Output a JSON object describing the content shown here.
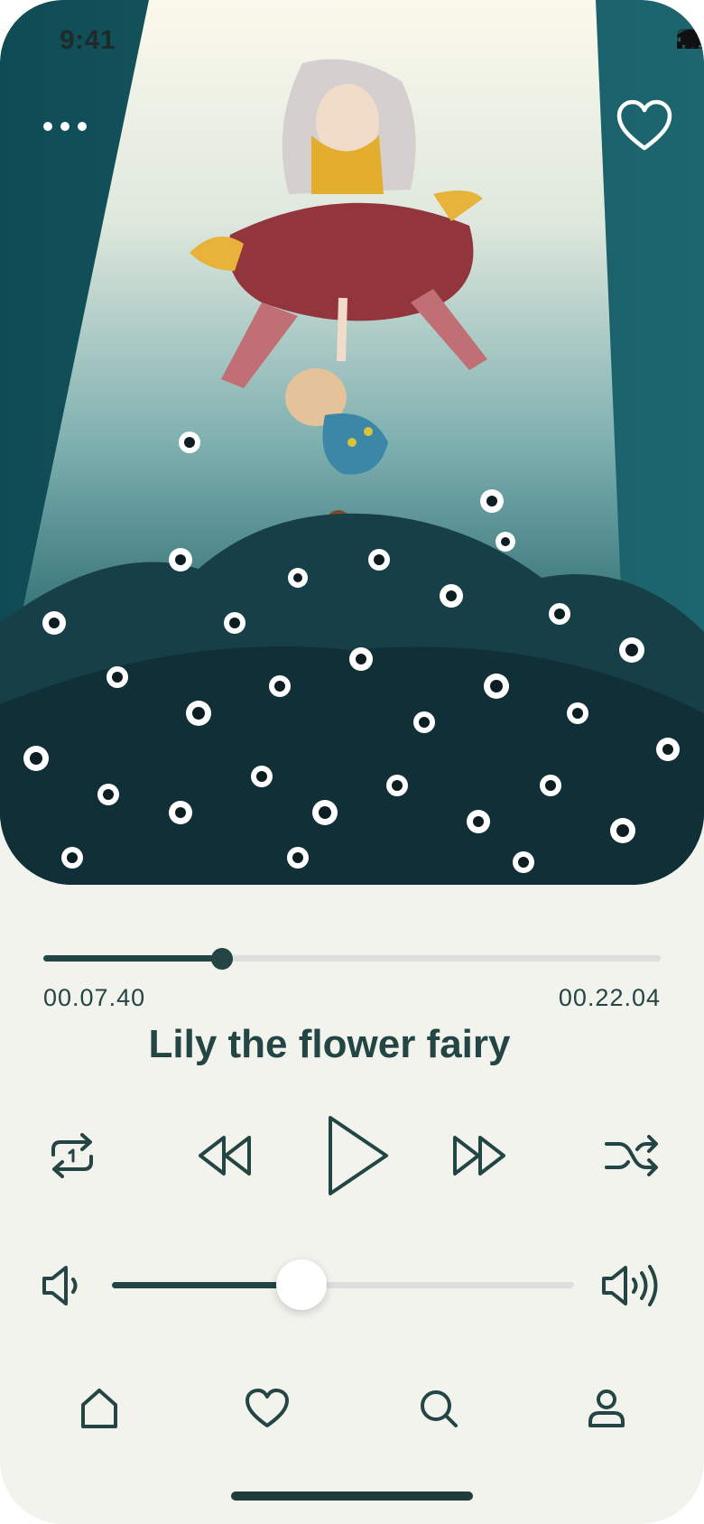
{
  "status_bar": {
    "time": "9:41"
  },
  "artwork": {
    "icons": [
      "more-dots-icon",
      "heart-icon"
    ]
  },
  "player": {
    "elapsed": "00.07.40",
    "total": "00.22.04",
    "progress": 0.29,
    "title": "Lily the flower fairy",
    "volume": 0.41
  },
  "controls": [
    "repeat-one-icon",
    "rewind-icon",
    "play-icon",
    "fast-forward-icon",
    "shuffle-icon"
  ],
  "volume_icons": [
    "volume-low-icon",
    "volume-high-icon"
  ],
  "tab_bar": [
    "home-icon",
    "heart-icon",
    "search-icon",
    "profile-icon"
  ],
  "colors": {
    "accent": "#234544",
    "background": "#f3f3ee",
    "track": "#dedede"
  }
}
